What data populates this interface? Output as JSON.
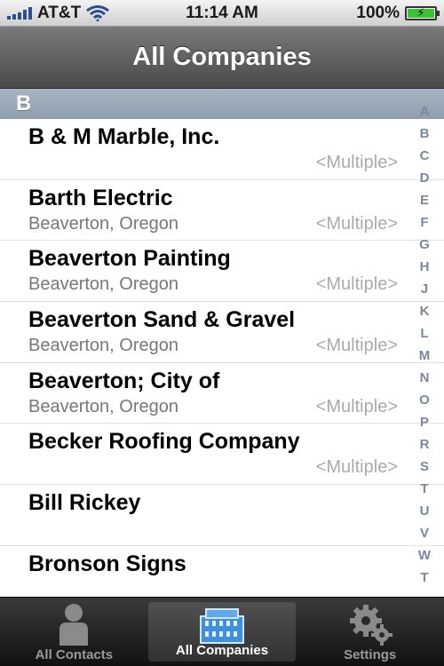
{
  "status_bar": {
    "carrier": "AT&T",
    "time": "11:14 AM",
    "battery_percent": "100%",
    "battery_level": 1.0,
    "signal_bars": 5,
    "icons": [
      "signal-icon",
      "wifi-icon",
      "battery-icon"
    ]
  },
  "nav": {
    "title": "All Companies"
  },
  "section": {
    "letter": "B"
  },
  "rows": [
    {
      "title": "B & M Marble, Inc.",
      "subtitle": "",
      "detail": "<Multiple>"
    },
    {
      "title": "Barth Electric",
      "subtitle": "Beaverton, Oregon",
      "detail": "<Multiple>"
    },
    {
      "title": "Beaverton Painting",
      "subtitle": "Beaverton, Oregon",
      "detail": "<Multiple>"
    },
    {
      "title": "Beaverton Sand & Gravel",
      "subtitle": "Beaverton, Oregon",
      "detail": "<Multiple>"
    },
    {
      "title": "Beaverton; City of",
      "subtitle": "Beaverton, Oregon",
      "detail": "<Multiple>"
    },
    {
      "title": "Becker Roofing Company",
      "subtitle": "",
      "detail": "<Multiple>"
    },
    {
      "title": "Bill Rickey",
      "subtitle": "",
      "detail": ""
    },
    {
      "title": "Bronson Signs",
      "subtitle": "",
      "detail": ""
    }
  ],
  "index_letters": [
    "A",
    "B",
    "C",
    "D",
    "E",
    "F",
    "G",
    "H",
    "J",
    "K",
    "L",
    "M",
    "N",
    "O",
    "P",
    "R",
    "S",
    "T",
    "U",
    "V",
    "W",
    "T"
  ],
  "tabs": [
    {
      "label": "All Contacts",
      "icon": "person-icon",
      "active": false
    },
    {
      "label": "All Companies",
      "icon": "building-icon",
      "active": true
    },
    {
      "label": "Settings",
      "icon": "gears-icon",
      "active": false
    }
  ],
  "colors": {
    "accent": "#3cc234",
    "section_header": "#97a6b5",
    "index_text": "#7a8899",
    "tab_active": "#ffffff",
    "tab_inactive": "#9a9a9a"
  }
}
